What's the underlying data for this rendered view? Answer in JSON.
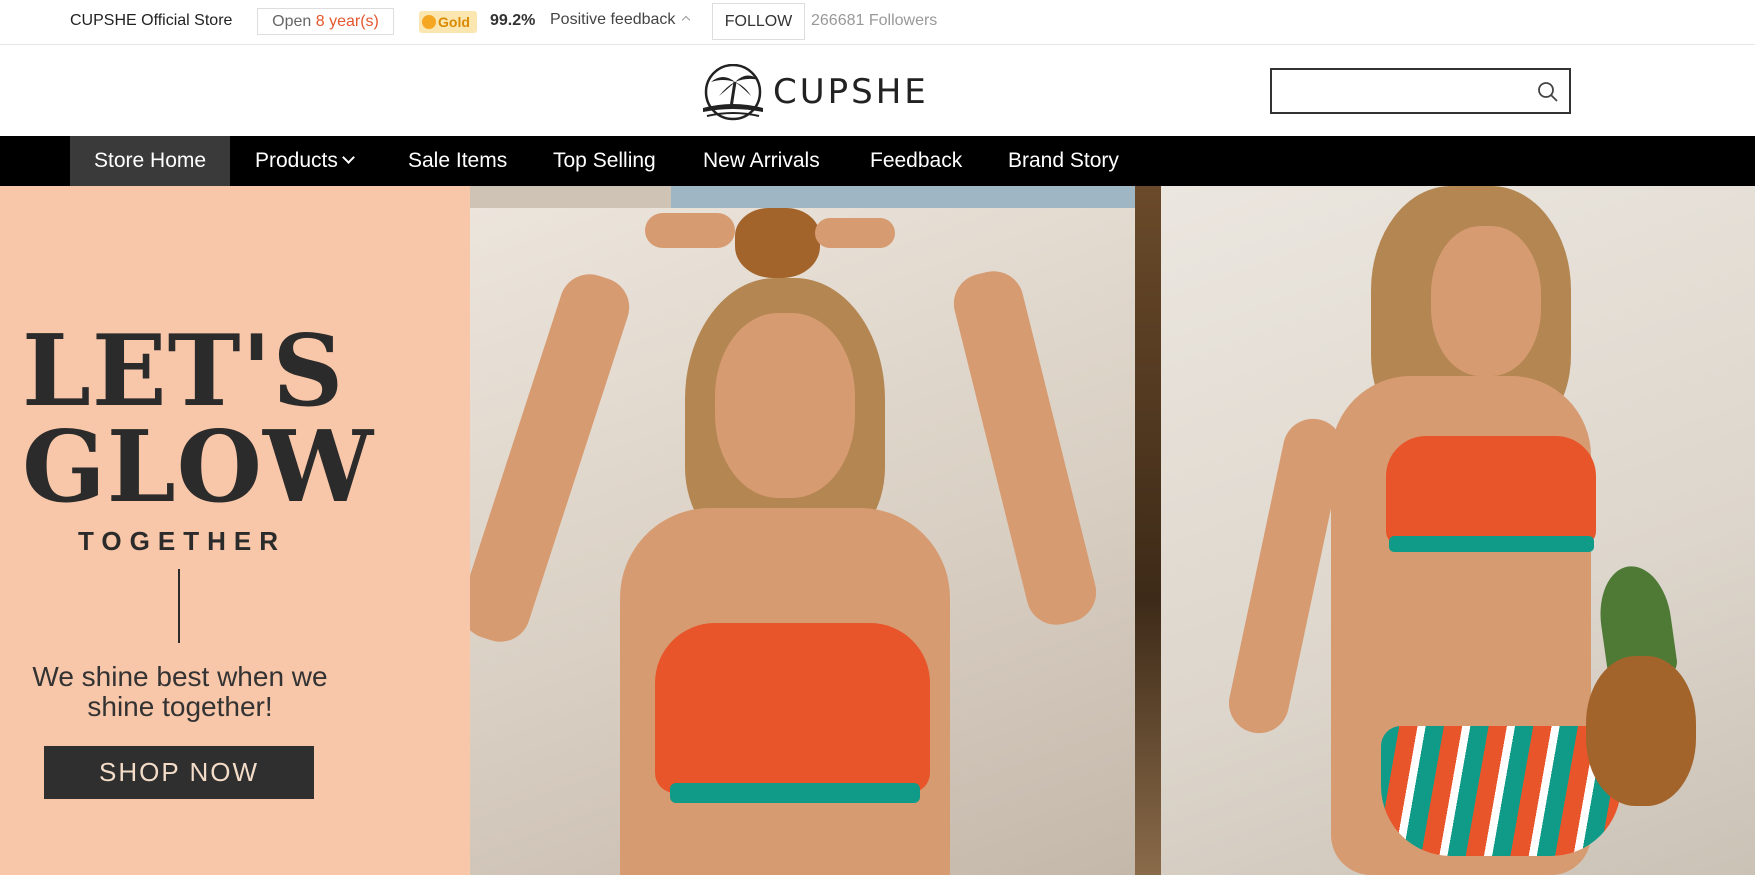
{
  "store_bar": {
    "store_name": "CUPSHE Official Store",
    "open_label": "Open",
    "open_years": "8 year(s)",
    "gold_label": "Gold",
    "rating": "99.2%",
    "feedback_label": "Positive feedback",
    "follow_label": "FOLLOW",
    "followers": "266681 Followers"
  },
  "header": {
    "logo_text": "CUPSHE",
    "search_placeholder": ""
  },
  "nav": {
    "items": [
      {
        "label": "Store Home",
        "active": true
      },
      {
        "label": "Products",
        "has_dropdown": true
      },
      {
        "label": "Sale Items"
      },
      {
        "label": "Top Selling"
      },
      {
        "label": "New Arrivals"
      },
      {
        "label": "Feedback"
      },
      {
        "label": "Brand Story"
      }
    ]
  },
  "banner": {
    "headline_line1": "LET'S",
    "headline_line2": "GLOW",
    "subhead": "TOGETHER",
    "tagline": "We shine best when we shine together!",
    "cta_label": "SHOP NOW"
  },
  "colors": {
    "nav_bg": "#000000",
    "nav_active_bg": "#3a3a3a",
    "banner_bg": "#f8c6a8",
    "accent": "#e4572e",
    "cta_bg": "#2f2f2f"
  },
  "icons": {
    "search": "search-icon",
    "logo": "palm-tree-icon",
    "dropdown": "chevron-down-icon",
    "feedback_toggle": "chevron-up-icon",
    "gold": "medal-icon"
  }
}
